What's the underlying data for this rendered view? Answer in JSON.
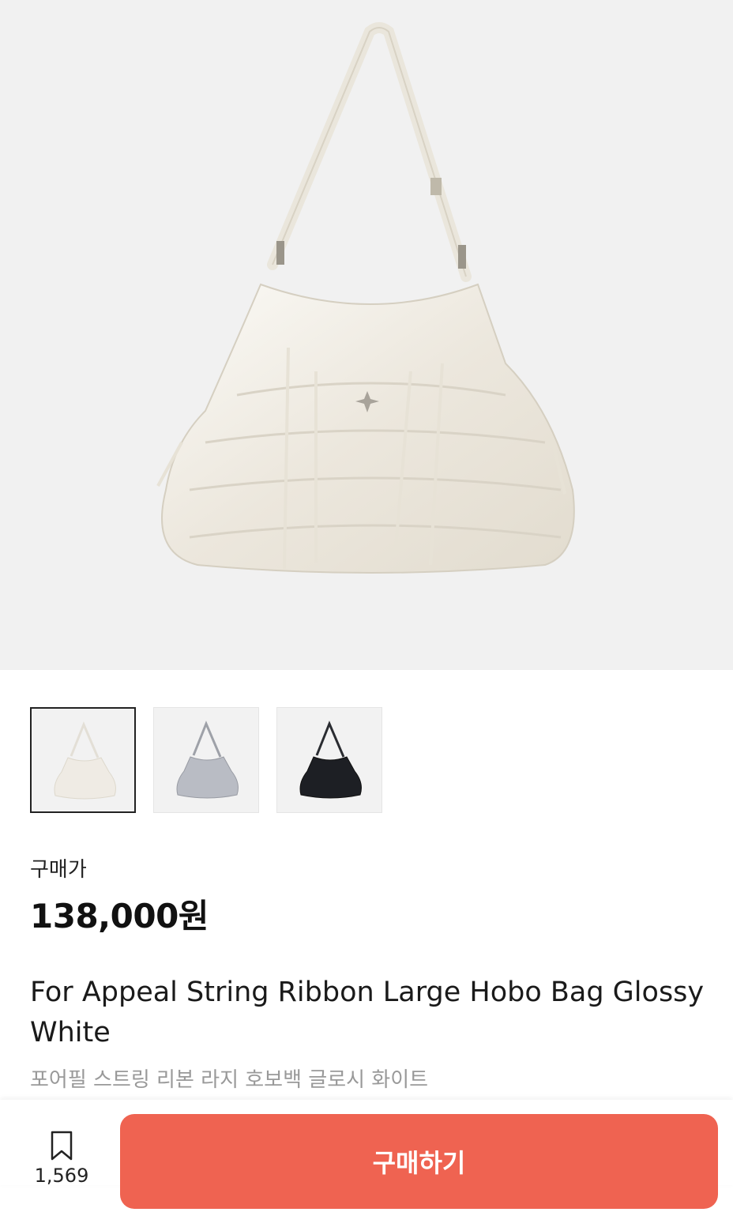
{
  "product": {
    "price_label": "구매가",
    "price": "138,000원",
    "name_en": "For Appeal String Ribbon Large Hobo Bag Glossy White",
    "name_ko": "포어필 스트링 리본 라지 호보백 글로시 화이트"
  },
  "thumbnails": [
    {
      "name": "thumbnail-white",
      "color": "#efebe4",
      "active": true
    },
    {
      "name": "thumbnail-silver",
      "color": "#b9bcc4",
      "active": false
    },
    {
      "name": "thumbnail-black",
      "color": "#1d1f24",
      "active": false
    }
  ],
  "bottom_bar": {
    "bookmark_icon": "bookmark-icon",
    "bookmark_count": "1,569",
    "buy_label": "구매하기"
  },
  "colors": {
    "accent": "#ef6351",
    "hero_bg": "#f1f1f1"
  }
}
